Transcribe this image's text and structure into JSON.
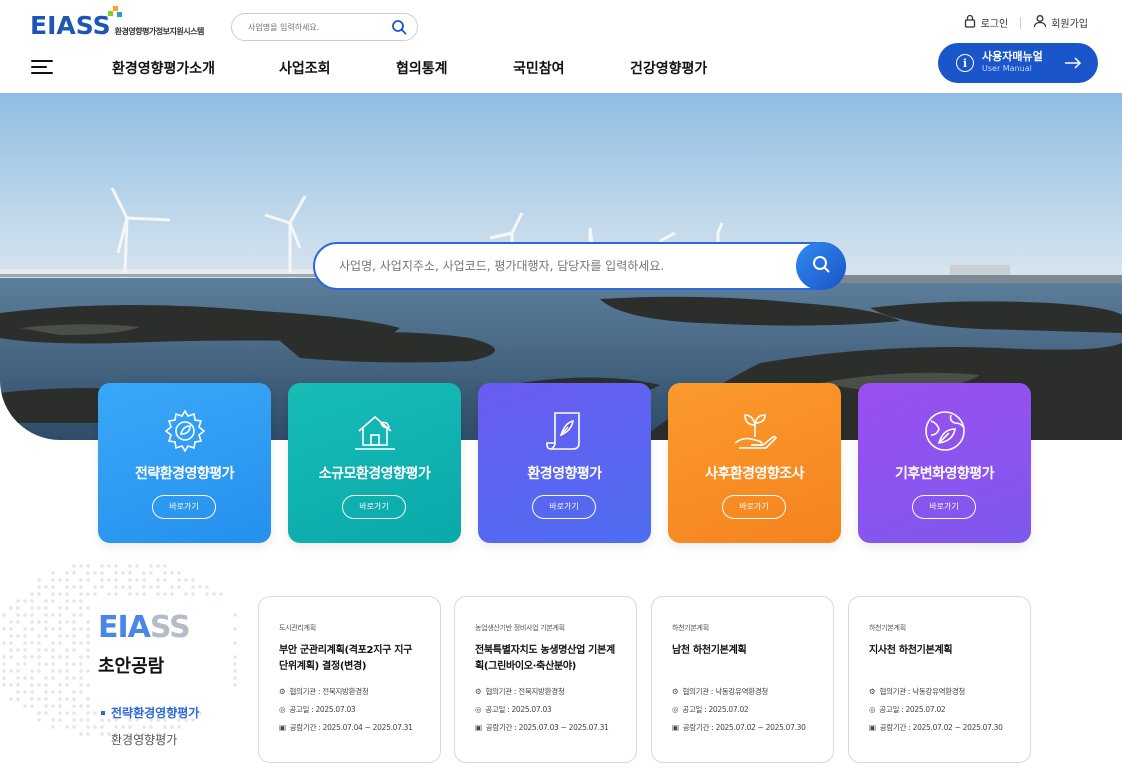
{
  "header": {
    "logo_text": "EIASS",
    "logo_sub": "환경영향평가정보지원시스템",
    "search_placeholder": "사업명을 입력하세요.",
    "login": "로그인",
    "signup": "회원가입",
    "manual_title": "사용자매뉴얼",
    "manual_sub": "User Manual"
  },
  "nav": [
    "환경영향평가소개",
    "사업조회",
    "협의통계",
    "국민참여",
    "건강영향평가"
  ],
  "hero": {
    "search_placeholder": "사업명, 사업지주소, 사업코드, 평가대행자, 담당자를 입력하세요."
  },
  "categories": [
    {
      "title": "전략환경영향평가",
      "button": "바로가기",
      "icon": "gear-leaf-icon",
      "color": "#2f9cf4"
    },
    {
      "title": "소규모환경영향평가",
      "button": "바로가기",
      "icon": "house-leaf-icon",
      "color": "#10b3b0"
    },
    {
      "title": "환경영향평가",
      "button": "바로가기",
      "icon": "scroll-leaf-icon",
      "color": "#5a66f0"
    },
    {
      "title": "사후환경영향조사",
      "button": "바로가기",
      "icon": "hand-sprout-icon",
      "color": "#f98c22"
    },
    {
      "title": "기후변화영향평가",
      "button": "바로가기",
      "icon": "globe-leaf-icon",
      "color": "#9051ec"
    }
  ],
  "drafts_section": {
    "brand_a": "EIA",
    "brand_b": "SS",
    "title": "초안공람",
    "tabs": [
      "전략환경영향평가",
      "환경영향평가"
    ]
  },
  "drafts": [
    {
      "category": "도시관리계획",
      "title": "부안 군관리계획(격포2지구 지구단위계획) 결정(변경)",
      "agency": "협의기관 : 전북지방환경청",
      "notice": "공고일 : 2025.07.03",
      "period": "공람기간 : 2025.07.04 ~ 2025.07.31"
    },
    {
      "category": "농업생산기반 정비사업 기본계획",
      "title": "전북특별자치도 농생명산업 기본계획(그린바이오·축산분야)",
      "agency": "협의기관 : 전북지방환경청",
      "notice": "공고일 : 2025.07.03",
      "period": "공람기간 : 2025.07.03 ~ 2025.07.31"
    },
    {
      "category": "하천기본계획",
      "title": "남천 하천기본계획",
      "agency": "협의기관 : 낙동강유역환경청",
      "notice": "공고일 : 2025.07.02",
      "period": "공람기간 : 2025.07.02 ~ 2025.07.30"
    },
    {
      "category": "하천기본계획",
      "title": "지사천 하천기본계획",
      "agency": "협의기관 : 낙동강유역환경청",
      "notice": "공고일 : 2025.07.02",
      "period": "공람기간 : 2025.07.02 ~ 2025.07.30"
    }
  ]
}
